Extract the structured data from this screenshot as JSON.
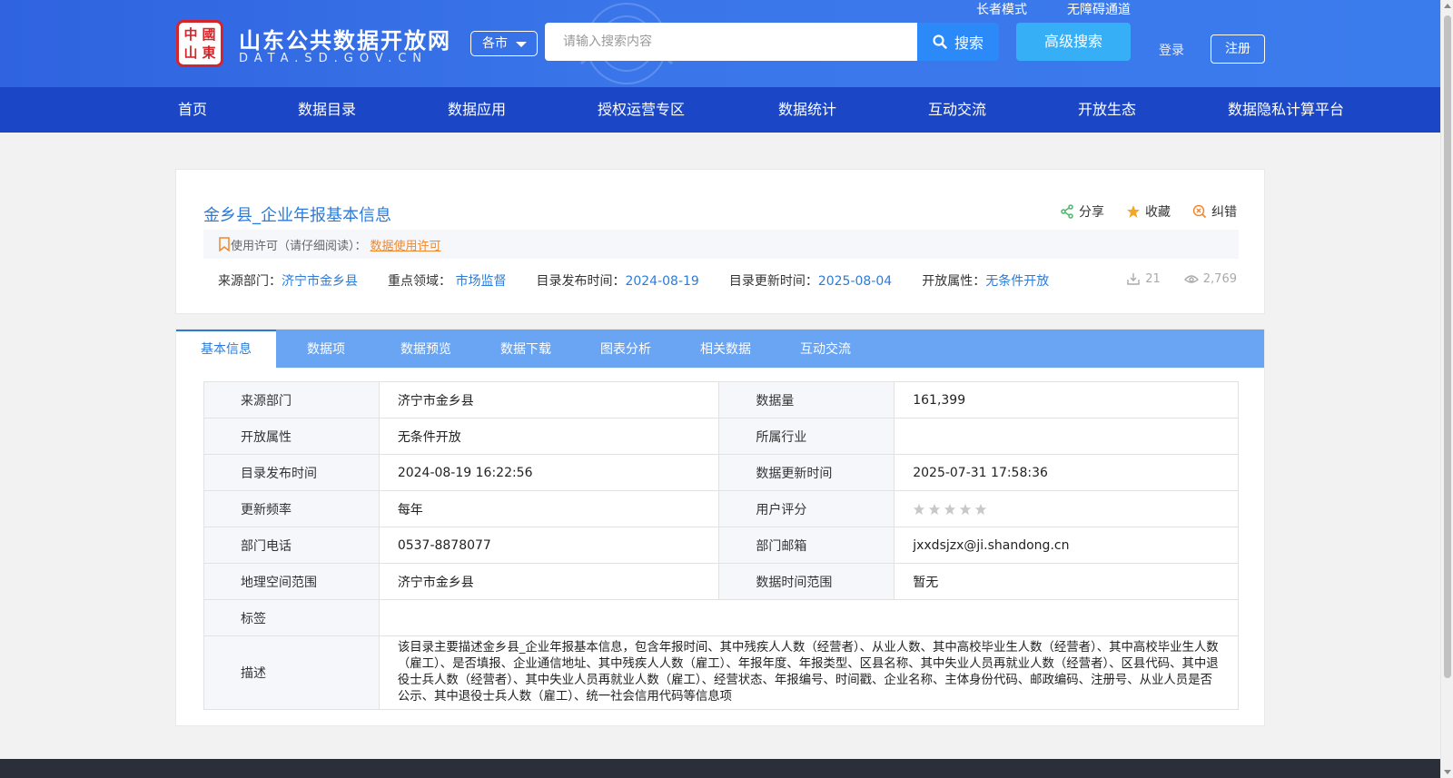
{
  "header": {
    "logo_seal_chars": [
      "中",
      "國",
      "山",
      "東"
    ],
    "site_title": "山东公共数据开放网",
    "site_subtitle": "DATA.SD.GOV.CN",
    "region_select": "各市",
    "search_placeholder": "请输入搜索内容",
    "search_button": "搜索",
    "advanced_search": "高级搜索",
    "elder_mode": "长者模式",
    "accessibility": "无障碍通道",
    "login": "登录",
    "register": "注册"
  },
  "nav": [
    "首页",
    "数据目录",
    "数据应用",
    "授权运营专区",
    "数据统计",
    "互动交流",
    "开放生态",
    "数据隐私计算平台"
  ],
  "dataset": {
    "title": "金乡县_企业年报基本信息",
    "actions": {
      "share": "分享",
      "favorite": "收藏",
      "report_error": "纠错"
    },
    "license_label": "使用许可（请仔细阅读）：",
    "license_link": "数据使用许可",
    "meta": {
      "source_label": "来源部门：",
      "source_value": "济宁市金乡县",
      "domain_label": "重点领域：",
      "domain_value": "市场监督",
      "publish_label": "目录发布时间：",
      "publish_value": "2024-08-19",
      "update_label": "目录更新时间：",
      "update_value": "2025-08-04",
      "open_label": "开放属性：",
      "open_value": "无条件开放"
    },
    "downloads": "21",
    "views": "2,769"
  },
  "tabs": [
    "基本信息",
    "数据项",
    "数据预览",
    "数据下载",
    "图表分析",
    "相关数据",
    "互动交流"
  ],
  "active_tab": "基本信息",
  "info_table": {
    "rows": [
      [
        "来源部门",
        "济宁市金乡县",
        "数据量",
        "161,399"
      ],
      [
        "开放属性",
        "无条件开放",
        "所属行业",
        ""
      ],
      [
        "目录发布时间",
        "2024-08-19 16:22:56",
        "数据更新时间",
        "2025-07-31 17:58:36"
      ],
      [
        "更新频率",
        "每年",
        "用户评分",
        ""
      ],
      [
        "部门电话",
        "0537-8878077",
        "部门邮箱",
        "jxxdsjzx@ji.shandong.cn"
      ],
      [
        "地理空间范围",
        "济宁市金乡县",
        "数据时间范围",
        "暂无"
      ]
    ],
    "tags_label": "标签",
    "tags_value": "",
    "desc_label": "描述",
    "desc_value": "该目录主要描述金乡县_企业年报基本信息，包含年报时间、其中残疾人人数（经营者）、从业人数、其中高校毕业生人数（经营者）、其中高校毕业生人数（雇工）、是否填报、企业通信地址、其中残疾人人数（雇工）、年报年度、年报类型、区县名称、其中失业人员再就业人数（经营者）、区县代码、其中退役士兵人数（经营者）、其中失业人员再就业人数（雇工）、经营状态、年报编号、时间戳、企业名称、主体身份代码、邮政编码、注册号、从业人员是否公示、其中退役士兵人数（雇工）、统一社会信用代码等信息项",
    "rating_stars": 0,
    "rating_max": 5
  },
  "colors": {
    "header_bg": "#3a76ea",
    "nav_bg": "#1b46c6",
    "tab_bar": "#6aa5f3",
    "accent_link": "#2d7bd8",
    "license_orange": "#f0882f"
  }
}
